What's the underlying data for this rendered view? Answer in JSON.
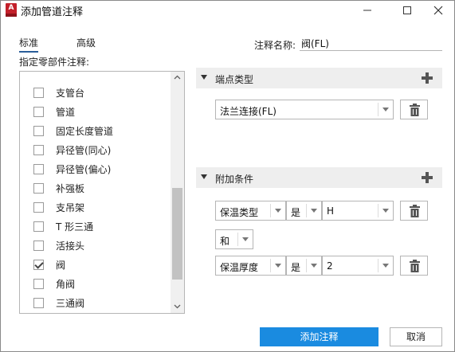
{
  "window": {
    "title": "添加管道注释",
    "app_icon_letter": "A",
    "minimize_icon": "minimize-icon",
    "maximize_icon": "maximize-icon",
    "close_icon": "close-icon"
  },
  "tabs": [
    {
      "label": "标准",
      "active": true
    },
    {
      "label": "高级",
      "active": false
    }
  ],
  "component_list": {
    "label": "指定零部件注释:",
    "items": [
      {
        "label": "支管台",
        "checked": false
      },
      {
        "label": "管道",
        "checked": false
      },
      {
        "label": "固定长度管道",
        "checked": false
      },
      {
        "label": "异径管(同心)",
        "checked": false
      },
      {
        "label": "异径管(偏心)",
        "checked": false
      },
      {
        "label": "补强板",
        "checked": false
      },
      {
        "label": "支吊架",
        "checked": false
      },
      {
        "label": "T 形三通",
        "checked": false
      },
      {
        "label": "活接头",
        "checked": false
      },
      {
        "label": "阀",
        "checked": true
      },
      {
        "label": "角阀",
        "checked": false
      },
      {
        "label": "三通阀",
        "checked": false
      }
    ]
  },
  "annotation_name": {
    "label": "注释名称:",
    "value": "阀(FL)"
  },
  "endpoint_section": {
    "title": "端点类型",
    "selected": "法兰连接(FL)"
  },
  "conditions_section": {
    "title": "附加条件",
    "rows": [
      {
        "property": "保温类型",
        "operator": "是",
        "value": "H"
      },
      {
        "property": "保温厚度",
        "operator": "是",
        "value": "2"
      }
    ],
    "joiner": "和"
  },
  "buttons": {
    "add": "添加注释",
    "cancel": "取消"
  },
  "colors": {
    "primary_button": "#1a8be0",
    "app_icon": "#c3202a",
    "active_tab_underline": "#2a5d99"
  }
}
